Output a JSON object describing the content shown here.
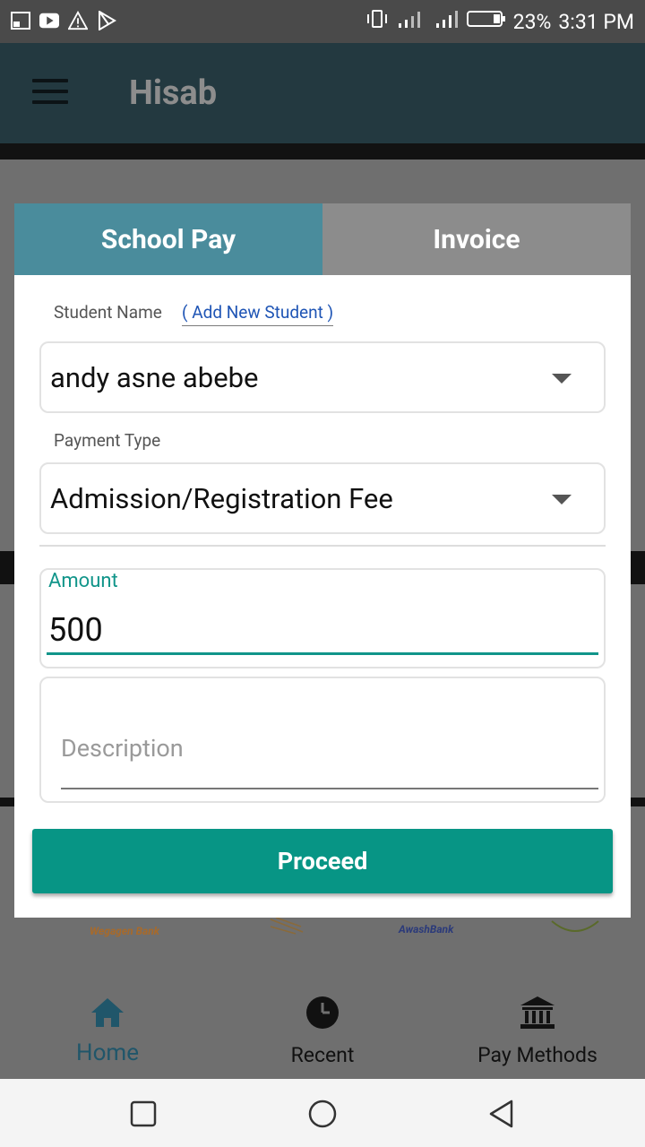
{
  "status_bar": {
    "battery": "23%",
    "time": "3:31 PM"
  },
  "app_bar": {
    "title": "Hisab"
  },
  "background": {
    "banks": [
      "Wegagen Bank",
      "AwashBank"
    ]
  },
  "bottom_nav": {
    "items": [
      {
        "label": "Home",
        "icon": "home-icon"
      },
      {
        "label": "Recent",
        "icon": "clock-icon"
      },
      {
        "label": "Pay Methods",
        "icon": "bank-icon"
      }
    ]
  },
  "dialog": {
    "tabs": [
      {
        "label": "School Pay",
        "active": true
      },
      {
        "label": "Invoice",
        "active": false
      }
    ],
    "student_name_label": "Student Name",
    "add_student_link": "( Add New Student )",
    "student_value": "andy asne abebe",
    "payment_type_label": "Payment Type",
    "payment_type_value": "Admission/Registration Fee",
    "amount_label": "Amount",
    "amount_value": "500",
    "description_placeholder": "Description",
    "proceed_label": "Proceed"
  },
  "colors": {
    "tab_active": "#4a8c9c",
    "tab_inactive": "#8c8c8c",
    "accent": "#079585"
  }
}
